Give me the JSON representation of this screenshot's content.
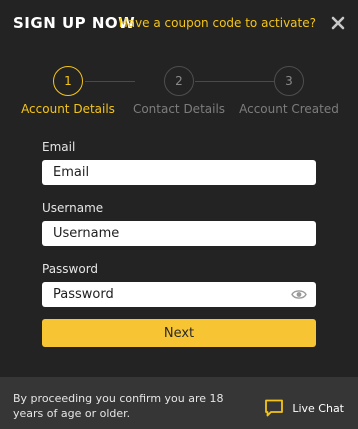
{
  "header": {
    "title": "SIGN UP NOW",
    "coupon_link": "Have a coupon code to activate?",
    "close_icon": "close-icon"
  },
  "steps": [
    {
      "number": "1",
      "label": "Account Details",
      "active": true
    },
    {
      "number": "2",
      "label": "Contact Details",
      "active": false
    },
    {
      "number": "3",
      "label": "Account Created",
      "active": false
    }
  ],
  "form": {
    "email": {
      "label": "Email",
      "placeholder": "Email",
      "value": ""
    },
    "username": {
      "label": "Username",
      "placeholder": "Username",
      "value": ""
    },
    "password": {
      "label": "Password",
      "placeholder": "Password",
      "value": "",
      "toggle_icon": "eye-icon"
    },
    "next_label": "Next"
  },
  "footer": {
    "disclaimer": "By proceeding you confirm you are 18 years of age or older.",
    "live_chat_label": "Live Chat",
    "chat_icon": "chat-bubble-icon"
  },
  "colors": {
    "background": "#232323",
    "accent": "#f5c518",
    "button": "#f7c534",
    "footer": "#363636",
    "muted": "#7d7d7d"
  }
}
